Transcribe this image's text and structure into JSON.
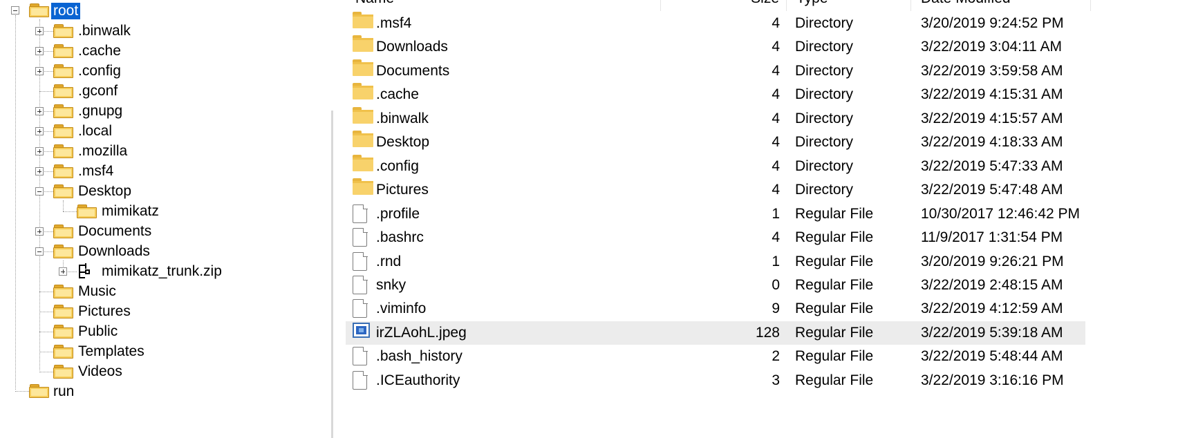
{
  "tree": {
    "root_label": "root",
    "items": [
      {
        "label": ".binwalk"
      },
      {
        "label": ".cache"
      },
      {
        "label": ".config"
      },
      {
        "label": ".gconf"
      },
      {
        "label": ".gnupg"
      },
      {
        "label": ".local"
      },
      {
        "label": ".mozilla"
      },
      {
        "label": ".msf4"
      },
      {
        "label": "Desktop"
      },
      {
        "label": "mimikatz"
      },
      {
        "label": "Documents"
      },
      {
        "label": "Downloads"
      },
      {
        "label": "mimikatz_trunk.zip"
      },
      {
        "label": "Music"
      },
      {
        "label": "Pictures"
      },
      {
        "label": "Public"
      },
      {
        "label": "Templates"
      },
      {
        "label": "Videos"
      }
    ],
    "sibling_label": "run"
  },
  "columns": {
    "name": "Name",
    "size": "Size",
    "type": "Type",
    "date": "Date Modified"
  },
  "files": [
    {
      "name": ".msf4",
      "size": "4",
      "type": "Directory",
      "date": "3/20/2019 9:24:52 PM",
      "icon": "folder-icon"
    },
    {
      "name": "Downloads",
      "size": "4",
      "type": "Directory",
      "date": "3/22/2019 3:04:11 AM",
      "icon": "folder-icon"
    },
    {
      "name": "Documents",
      "size": "4",
      "type": "Directory",
      "date": "3/22/2019 3:59:58 AM",
      "icon": "folder-icon"
    },
    {
      "name": ".cache",
      "size": "4",
      "type": "Directory",
      "date": "3/22/2019 4:15:31 AM",
      "icon": "folder-icon"
    },
    {
      "name": ".binwalk",
      "size": "4",
      "type": "Directory",
      "date": "3/22/2019 4:15:57 AM",
      "icon": "folder-icon"
    },
    {
      "name": "Desktop",
      "size": "4",
      "type": "Directory",
      "date": "3/22/2019 4:18:33 AM",
      "icon": "folder-icon"
    },
    {
      "name": ".config",
      "size": "4",
      "type": "Directory",
      "date": "3/22/2019 5:47:33 AM",
      "icon": "folder-icon"
    },
    {
      "name": "Pictures",
      "size": "4",
      "type": "Directory",
      "date": "3/22/2019 5:47:48 AM",
      "icon": "folder-icon"
    },
    {
      "name": ".profile",
      "size": "1",
      "type": "Regular File",
      "date": "10/30/2017 12:46:42 PM",
      "icon": "file-icon"
    },
    {
      "name": ".bashrc",
      "size": "4",
      "type": "Regular File",
      "date": "11/9/2017 1:31:54 PM",
      "icon": "file-icon"
    },
    {
      "name": ".rnd",
      "size": "1",
      "type": "Regular File",
      "date": "3/20/2019 9:26:21 PM",
      "icon": "file-icon"
    },
    {
      "name": "snky",
      "size": "0",
      "type": "Regular File",
      "date": "3/22/2019 2:48:15 AM",
      "icon": "file-icon"
    },
    {
      "name": ".viminfo",
      "size": "9",
      "type": "Regular File",
      "date": "3/22/2019 4:12:59 AM",
      "icon": "file-icon"
    },
    {
      "name": "irZLAohL.jpeg",
      "size": "128",
      "type": "Regular File",
      "date": "3/22/2019 5:39:18 AM",
      "icon": "image-icon"
    },
    {
      "name": ".bash_history",
      "size": "2",
      "type": "Regular File",
      "date": "3/22/2019 5:48:44 AM",
      "icon": "file-icon"
    },
    {
      "name": ".ICEauthority",
      "size": "3",
      "type": "Regular File",
      "date": "3/22/2019 3:16:16 PM",
      "icon": "file-icon"
    }
  ]
}
